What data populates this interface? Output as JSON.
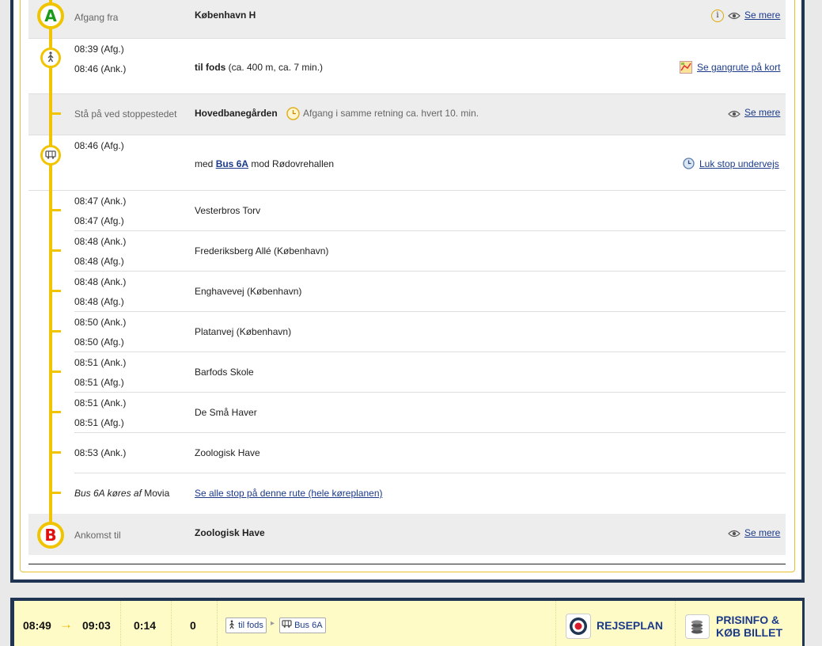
{
  "journey": {
    "departure": {
      "badge": "A",
      "label": "Afgang fra",
      "station": "København H",
      "more": "Se mere",
      "info_glyph": "i"
    },
    "walk": {
      "time_dep": "08:39 (Afg.)",
      "time_arr": "08:46 (Ank.)",
      "mode": "til fods",
      "detail": "(ca. 400 m, ca. 7 min.)",
      "map_link": "Se gangrute på kort"
    },
    "boarding": {
      "label": "Stå på ved stoppestedet",
      "stop": "Hovedbanegården",
      "frequency": "Afgang i samme retning ca. hvert 10. min.",
      "more": "Se mere"
    },
    "bus": {
      "time_dep": "08:46 (Afg.)",
      "prefix": "med",
      "line": "Bus 6A",
      "direction": "mod Rødovrehallen",
      "stops_link": "Luk stop undervejs"
    },
    "stops": [
      {
        "arr": "08:47 (Ank.)",
        "dep": "08:47 (Afg.)",
        "name": "Vesterbros Torv"
      },
      {
        "arr": "08:48 (Ank.)",
        "dep": "08:48 (Afg.)",
        "name": "Frederiksberg Allé (København)"
      },
      {
        "arr": "08:48 (Ank.)",
        "dep": "08:48 (Afg.)",
        "name": "Enghavevej (København)"
      },
      {
        "arr": "08:50 (Ank.)",
        "dep": "08:50 (Afg.)",
        "name": "Platanvej (København)"
      },
      {
        "arr": "08:51 (Ank.)",
        "dep": "08:51 (Afg.)",
        "name": "Barfods Skole"
      },
      {
        "arr": "08:51 (Ank.)",
        "dep": "08:51 (Afg.)",
        "name": "De Små Haver"
      },
      {
        "arr": "08:53 (Ank.)",
        "dep": "",
        "name": "Zoologisk Have"
      }
    ],
    "operator": {
      "line_text": "Bus 6A køres af",
      "company": "Movia",
      "all_stops_link": "Se alle stop på denne rute (hele køreplanen)"
    },
    "arrival": {
      "badge": "B",
      "label": "Ankomst til",
      "station": "Zoologisk Have",
      "more": "Se mere"
    }
  },
  "summary": {
    "depart": "08:49",
    "arrive": "09:03",
    "duration": "0:14",
    "changes": "0",
    "chip_walk": "til fods",
    "chip_bus": "Bus 6A",
    "rejseplan": "REJSEPLAN",
    "prisinfo_line1": "PRISINFO &",
    "prisinfo_line2": "KØB BILLET"
  },
  "colors": {
    "accent_yellow": "#f0c400",
    "navy": "#1f3553",
    "link": "#1b3a8a",
    "badge_a": "#1a9a1a",
    "badge_b": "#e01010"
  }
}
